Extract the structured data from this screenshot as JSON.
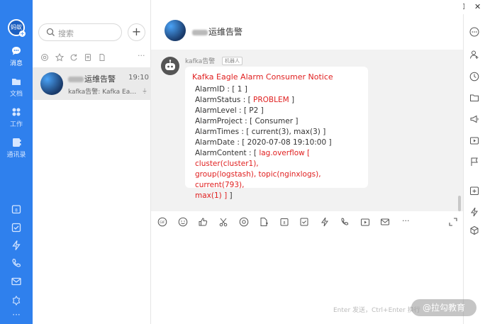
{
  "window": {
    "minimize": "—",
    "maximize": "☐",
    "close": "✕"
  },
  "me": {
    "avatar_text": "蚂蚁",
    "plus": "+"
  },
  "nav": [
    {
      "key": "messages",
      "label": "消息",
      "icon": "chat-icon"
    },
    {
      "key": "docs",
      "label": "文档",
      "icon": "folder-icon"
    },
    {
      "key": "work",
      "label": "工作",
      "icon": "grid-icon"
    },
    {
      "key": "contacts",
      "label": "通讯录",
      "icon": "contacts-icon"
    }
  ],
  "tools_left": [
    "calendar-icon",
    "check-icon",
    "bolt-icon",
    "phone-icon",
    "mail-icon",
    "cloud-icon",
    "more-icon"
  ],
  "tools_left_more": "···",
  "search": {
    "placeholder": "搜索",
    "add": "+"
  },
  "filter_more": "···",
  "conversation": {
    "name_suffix": "运维告警",
    "time": "19:10",
    "preview": "kafka告警: Kafka Eagle...",
    "mute": "⏚"
  },
  "chat_header": {
    "title_suffix": "运维告警"
  },
  "message": {
    "sender": "kafka告警",
    "tag": "机器人",
    "title": "Kafka Eagle Alarm Consumer Notice",
    "lines": [
      {
        "label": "AlarmID : [ ",
        "value": "1",
        "suffix": " ]",
        "red": false
      },
      {
        "label": "AlarmStatus : [ ",
        "value": "PROBLEM",
        "suffix": " ]",
        "red": true
      },
      {
        "label": "AlarmLevel : [ ",
        "value": "P2",
        "suffix": " ]",
        "red": false
      },
      {
        "label": "AlarmProject : [ ",
        "value": "Consumer",
        "suffix": " ]",
        "red": false
      },
      {
        "label": "AlarmTimes : [ ",
        "value": "current(3), max(3)",
        "suffix": " ]",
        "red": false
      },
      {
        "label": "AlarmDate : [ ",
        "value": "2020-07-08 19:10:00",
        "suffix": " ]",
        "red": false
      }
    ],
    "content_label": "AlarmContent : [ ",
    "content_red_1": "lag.overflow [ cluster(cluster1),",
    "content_red_2": "group(logstash), topic(nginxlogs), current(793),",
    "content_red_3": "max(1) ]",
    "content_suffix": " ]"
  },
  "input_hint": "Enter 发送，Ctrl+Enter 换行",
  "toolbar_more": "···",
  "watermark": "@拉勾教育",
  "colors": {
    "brand": "#2f80ed",
    "alert": "#e02020"
  }
}
